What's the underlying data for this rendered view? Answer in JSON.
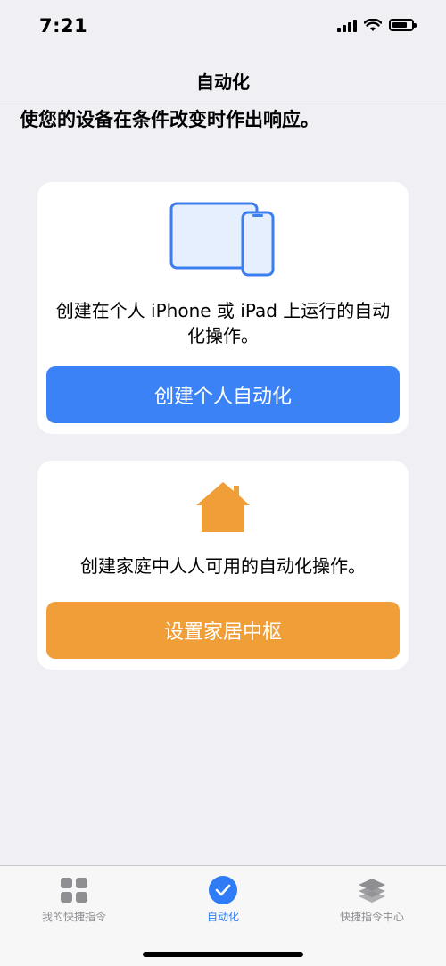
{
  "status_bar": {
    "time": "7:21"
  },
  "nav": {
    "title": "自动化"
  },
  "subtitle": "使您的设备在条件改变时作出响应。",
  "personal_card": {
    "icon": "iphone-ipad-icon",
    "description": "创建在个人 iPhone 或 iPad 上运行的自动化操作。",
    "button_label": "创建个人自动化",
    "button_color": "#3b82f6"
  },
  "home_card": {
    "icon": "house-icon",
    "description": "创建家庭中人人可用的自动化操作。",
    "button_label": "设置家居中枢",
    "button_color": "#f09e38"
  },
  "tab_bar": {
    "tabs": [
      {
        "label": "我的快捷指令",
        "icon": "grid-icon",
        "selected": false
      },
      {
        "label": "自动化",
        "icon": "checkmark-circle-icon",
        "selected": true
      },
      {
        "label": "快捷指令中心",
        "icon": "layers-icon",
        "selected": false
      }
    ],
    "accent_color": "#2f7cf6"
  }
}
